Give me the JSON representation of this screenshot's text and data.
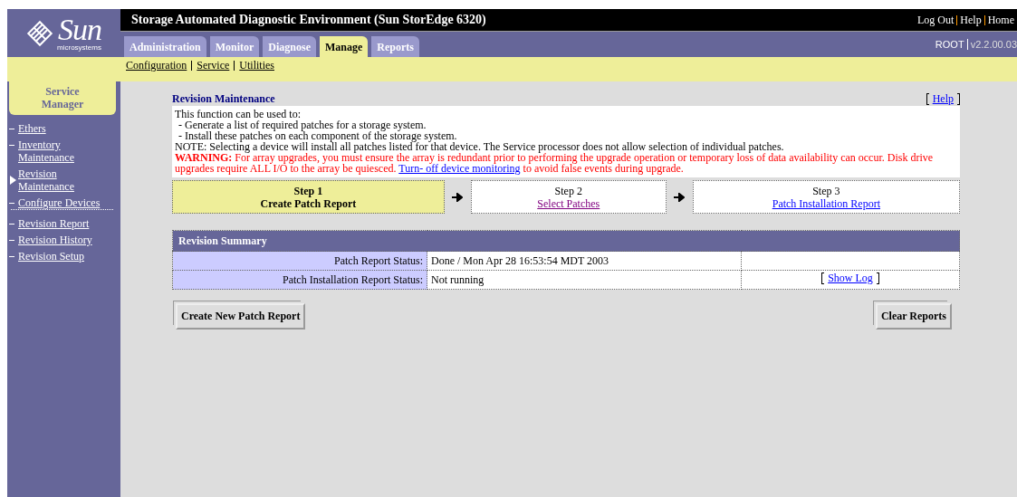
{
  "logo": {
    "name": "Sun",
    "tagline": "microsystems"
  },
  "window": {
    "title": "Storage Automated Diagnostic Environment (Sun StorEdge 6320)"
  },
  "top_links": [
    "Log Out",
    "Help",
    "Home"
  ],
  "tabs": [
    {
      "label": "Administration",
      "selected": false
    },
    {
      "label": "Monitor",
      "selected": false
    },
    {
      "label": "Diagnose",
      "selected": false
    },
    {
      "label": "Manage",
      "selected": true
    },
    {
      "label": "Reports",
      "selected": false
    }
  ],
  "user": "ROOT",
  "version": "v2.2.00.03",
  "subnav": [
    "Configuration",
    "Service",
    "Utilities"
  ],
  "sidebar": {
    "title": "Service Manager",
    "groups": [
      [
        {
          "label": "Ethers",
          "selected": false
        },
        {
          "label": "Inventory Maintenance",
          "selected": false
        },
        {
          "label": "Revision Maintenance",
          "selected": true
        },
        {
          "label": "Configure Devices",
          "selected": false
        }
      ],
      [
        {
          "label": "Revision Report",
          "selected": false
        },
        {
          "label": "Revision History",
          "selected": false
        },
        {
          "label": "Revision Setup",
          "selected": false
        }
      ]
    ]
  },
  "page": {
    "title": "Revision Maintenance",
    "help": "Help"
  },
  "intro": {
    "lines": [
      "This function can be used to:",
      "- Generate a list of required patches for a storage system.",
      "- Install these patches on each component of the storage system.",
      "NOTE: Selecting a device will install all patches listed for that device. The Service processor does not allow selection of individual patches."
    ],
    "warning": "**WARNING:** For array upgrades, you must ensure the array is redundant prior to performing the upgrade operation or temporary loss of data availability can occur. Disk drive upgrades require ALL I/O to the array be quiesced.",
    "warning_link": "Turn- off device monitoring",
    "warning_after": "to avoid false events during upgrade."
  },
  "steps": [
    {
      "step": "Step 1",
      "label": "Create Patch Report",
      "selected": true
    },
    {
      "step": "Step 2",
      "label": "Select Patches",
      "selected": false,
      "visited": true
    },
    {
      "step": "Step 3",
      "label": "Patch Installation Report",
      "selected": false,
      "visited": false
    }
  ],
  "summary": {
    "title": "Revision Summary",
    "rows": [
      {
        "label": "Patch Report Status:",
        "value": "Done / Mon Apr 28 16:53:54 MDT 2003"
      },
      {
        "label": "Patch Installation Report Status:",
        "value": "Not running",
        "action": "Show Log"
      }
    ]
  },
  "buttons": [
    "Create New Patch Report",
    "Clear Reports"
  ]
}
